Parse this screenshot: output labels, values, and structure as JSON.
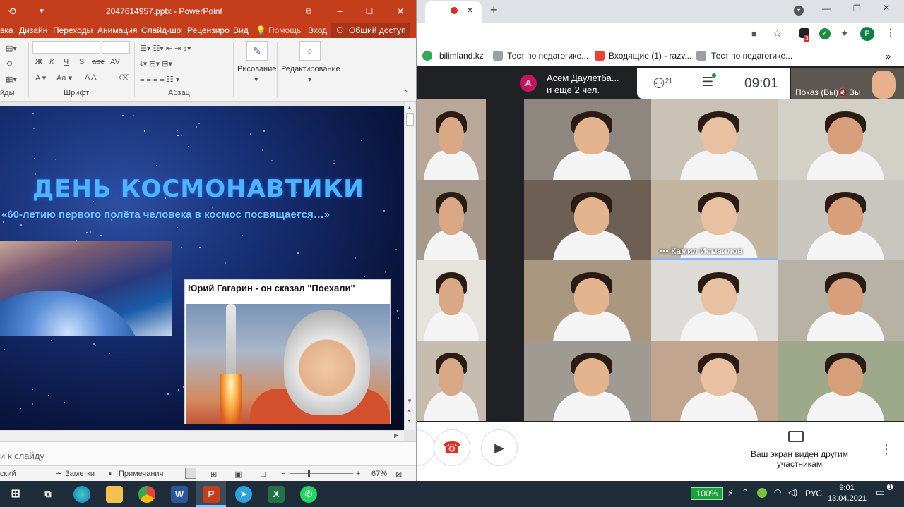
{
  "ppt": {
    "title": "2047614957.pptx  -  PowerPoint",
    "tabs": [
      "вка",
      "Дизайн",
      "Переходы",
      "Анимация",
      "Слайд-шоу",
      "Рецензиро",
      "Вид",
      "Помощь",
      "Вход",
      "Общий доступ"
    ],
    "ribbon": {
      "group_left": "йды",
      "group_font": "Шрифт",
      "group_paragraph": "Абзац",
      "draw_label": "Рисование",
      "edit_label": "Редактирование"
    },
    "slide": {
      "title": "ДЕНЬ КОСМОНАВТИКИ",
      "subtitle": "«60-летию первого полёта человека в космос посвящается…»",
      "photo_caption": "Юрий Гагарин - он сказал \"Поехали\""
    },
    "notes_placeholder": "и к слайду",
    "status": {
      "language": "ский",
      "notes_btn": "Заметки",
      "comments_btn": "Примечания",
      "zoom": "67%"
    }
  },
  "chrome": {
    "bookmarks": [
      "bilimland.kz",
      "Тест по педагогике...",
      "Входящие (1) - razv...",
      "Тест по педагогике..."
    ],
    "profile_initial": "Р",
    "extension_badge": "3"
  },
  "meet": {
    "presenter_initial": "А",
    "presenter_name": "Асем Даулетба...",
    "presenter_more": "и еще 2 чел.",
    "participant_count": "21",
    "time": "09:01",
    "self_label": "Показ (Вы)",
    "self_name": "Вы",
    "speaker_name": "Камил Исмаилов",
    "present_message": "Ваш экран виден другим участникам"
  },
  "taskbar": {
    "battery": "100%",
    "language": "РУС",
    "time": "9:01",
    "date": "13.04.2021"
  },
  "colors": {
    "ppt_accent": "#c43e1c",
    "meet_bg": "#202124",
    "end_call": "#d93025",
    "speaking": "#8ab4f8"
  }
}
